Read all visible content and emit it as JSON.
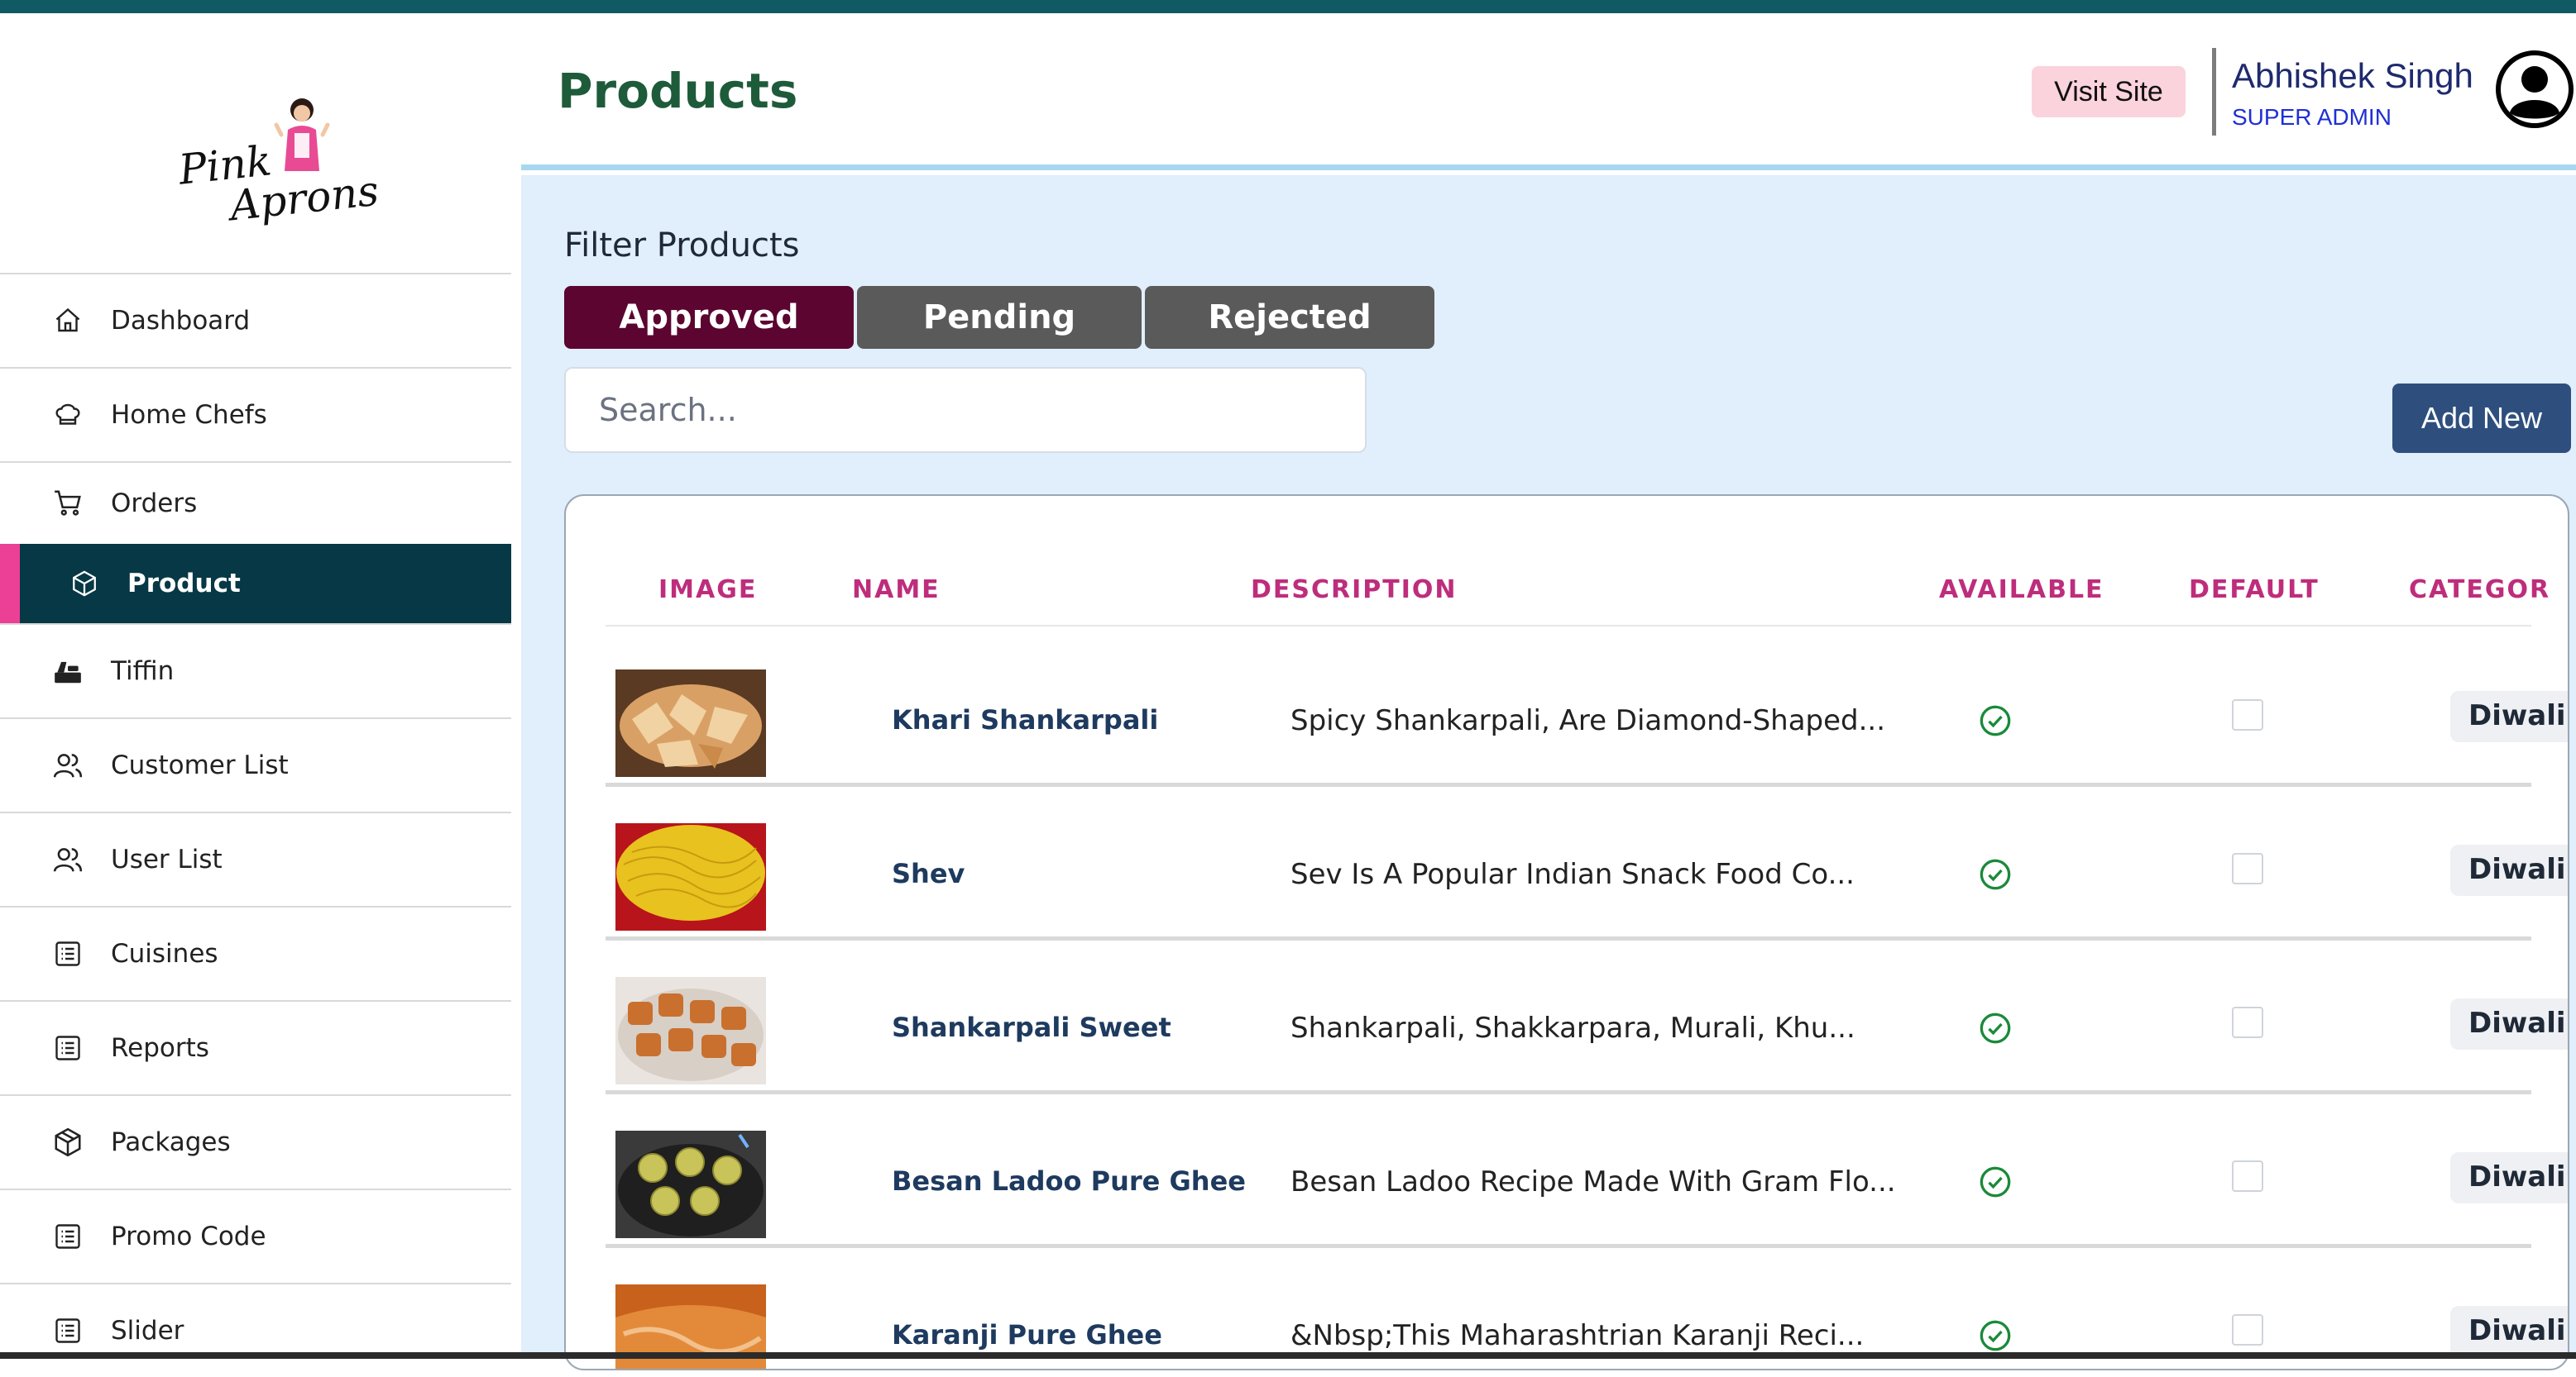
{
  "header": {
    "title": "Products",
    "visit_site_label": "Visit Site",
    "user_name": "Abhishek Singh",
    "user_role": "SUPER ADMIN"
  },
  "brand": {
    "logo_line1": "Pink",
    "logo_line2": "Aprons"
  },
  "sidebar": {
    "items": [
      {
        "label": "Dashboard",
        "icon": "home-icon"
      },
      {
        "label": "Home Chefs",
        "icon": "chef-hat-icon"
      },
      {
        "label": "Orders",
        "icon": "cart-icon"
      },
      {
        "label": "Product",
        "icon": "box-icon",
        "active": true
      },
      {
        "label": "Tiffin",
        "icon": "tiffin-icon"
      },
      {
        "label": "Customer List",
        "icon": "users-icon"
      },
      {
        "label": "User List",
        "icon": "users-icon"
      },
      {
        "label": "Cuisines",
        "icon": "list-icon"
      },
      {
        "label": "Reports",
        "icon": "list-icon"
      },
      {
        "label": "Packages",
        "icon": "package-icon"
      },
      {
        "label": "Promo Code",
        "icon": "list-icon"
      },
      {
        "label": "Slider",
        "icon": "list-icon"
      }
    ]
  },
  "filter": {
    "title": "Filter Products",
    "tabs": [
      "Approved",
      "Pending",
      "Rejected"
    ],
    "active_tab": "Approved",
    "search_placeholder": "Search...",
    "search_value": "",
    "add_new_label": "Add New"
  },
  "table": {
    "columns": [
      "IMAGE",
      "NAME",
      "DESCRIPTION",
      "AVAILABLE",
      "DEFAULT",
      "CATEGOR"
    ],
    "rows": [
      {
        "name": "Khari Shankarpali",
        "description": "Spicy Shankarpali, Are Diamond-Shaped...",
        "available": true,
        "default": false,
        "category": "Diwali S"
      },
      {
        "name": "Shev",
        "description": "Sev Is A Popular Indian Snack Food Co...",
        "available": true,
        "default": false,
        "category": "Diwali S"
      },
      {
        "name": "Shankarpali Sweet",
        "description": "Shankarpali, Shakkarpara, Murali, Khu...",
        "available": true,
        "default": false,
        "category": "Diwali S"
      },
      {
        "name": "Besan Ladoo Pure Ghee",
        "description": "Besan Ladoo Recipe Made With Gram Flo...",
        "available": true,
        "default": false,
        "category": "Diwali S"
      },
      {
        "name": "Karanji Pure Ghee",
        "description": "&Nbsp;This Maharashtrian Karanji Reci...",
        "available": true,
        "default": false,
        "category": "Diwali S"
      }
    ]
  },
  "colors": {
    "topbar": "#0f5a63",
    "sidebar_active": "#063845",
    "accent_pink": "#ec3f96",
    "tab_active": "#5b0530",
    "tab_inactive": "#5a5a5a",
    "title_green": "#1e5b3a",
    "column_header": "#be2d7c",
    "add_new": "#2e4f7e",
    "available_check": "#1a8a3a"
  }
}
